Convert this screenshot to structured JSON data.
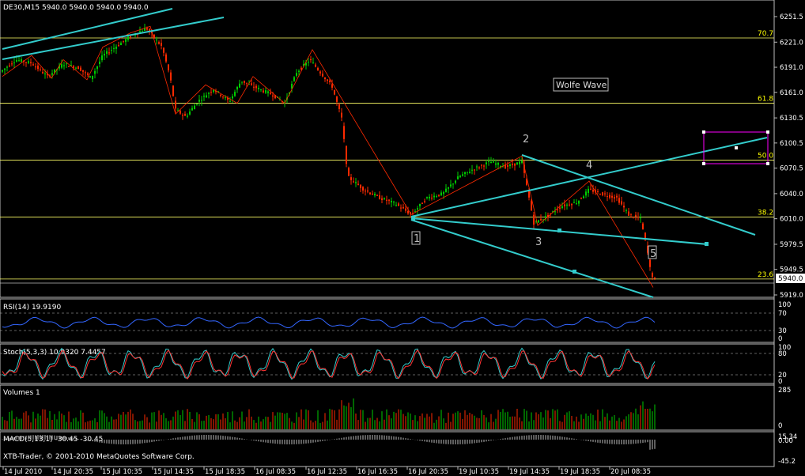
{
  "header": {
    "title": "DE30,M15  5940.0 5940.0 5940.0 5940.0"
  },
  "footer": {
    "copyright": "XTB-Trader, © 2001-2010 MetaQuotes Software Corp."
  },
  "annotations": {
    "wolfe_label": "Wolfe Wave",
    "wave_numbers": [
      "1",
      "2",
      "3",
      "4",
      "5"
    ]
  },
  "colors": {
    "background": "#000000",
    "bull_candle": "#00cc00",
    "bear_candle": "#ff2a00",
    "trendline": "#33cccc",
    "fib_line": "#ffff66",
    "rsi_line": "#3366ff",
    "stoch_main": "#33cccc",
    "stoch_signal": "#ff3333",
    "volume": "#cc0000",
    "zigzag": "#ff2a00",
    "box": "#ff00ff"
  },
  "chart_data": {
    "type": "candlestick",
    "symbol": "DE30",
    "timeframe": "M15",
    "price_axis_ticks": [
      "6251.5",
      "6221.0",
      "6191.0",
      "6161.0",
      "6130.5",
      "6100.5",
      "6070.5",
      "6040.0",
      "6010.0",
      "5979.5",
      "5949.5",
      "5919.0"
    ],
    "current_price": "5940.0",
    "fib_levels": [
      {
        "label": "70.7",
        "price": 6226.0
      },
      {
        "label": "61.8",
        "price": 6148.0
      },
      {
        "label": "50.0",
        "price": 6080.0
      },
      {
        "label": "38.2",
        "price": 6012.0
      },
      {
        "label": "23.6",
        "price": 5938.0
      }
    ],
    "time_labels": [
      "14 Jul 2010",
      "14 Jul 20:35",
      "15 Jul 10:35",
      "15 Jul 14:35",
      "15 Jul 18:35",
      "16 Jul 08:35",
      "16 Jul 12:35",
      "16 Jul 16:35",
      "16 Jul 20:35",
      "19 Jul 10:35",
      "19 Jul 14:35",
      "19 Jul 18:35",
      "20 Jul 08:35"
    ],
    "indicators": [
      {
        "name": "RSI(14) 19.9190",
        "ticks": [
          "100",
          "70",
          "30",
          "0"
        ]
      },
      {
        "name": "Stoch(5,3,3) 10.9320 7.4457",
        "ticks": [
          "100",
          "80",
          "20",
          "0"
        ]
      },
      {
        "name": "Volumes 1",
        "ticks": [
          "285",
          "0"
        ]
      },
      {
        "name": "MACD(5,13,1) -30.45 -30.45",
        "ticks": [
          "15.34",
          "0.00",
          "-45.2"
        ]
      }
    ]
  }
}
